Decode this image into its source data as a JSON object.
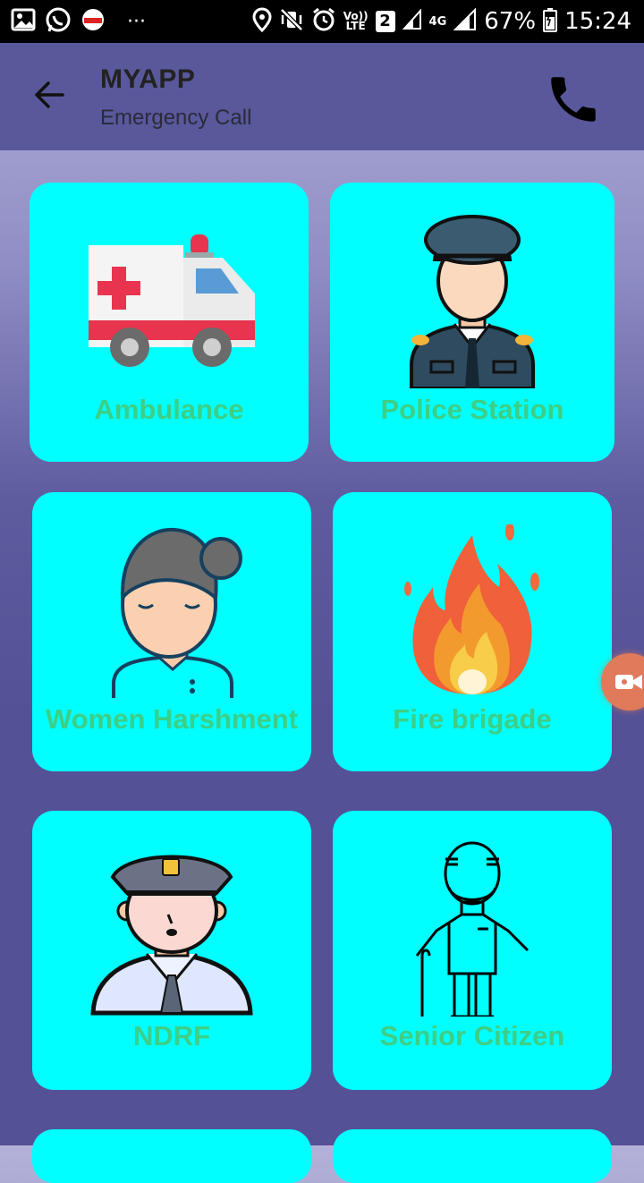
{
  "status_bar": {
    "lte_line1": "Vo))",
    "lte_line2": "LTE",
    "sim_badge": "2",
    "network": "4G",
    "battery": "67%",
    "time": "15:24",
    "dots": "···"
  },
  "app_bar": {
    "title": "MYAPP",
    "subtitle": "Emergency Call"
  },
  "cards": [
    {
      "label": "Ambulance"
    },
    {
      "label": "Police Station"
    },
    {
      "label": "Women Harshment"
    },
    {
      "label": "Fire brigade"
    },
    {
      "label": "NDRF"
    },
    {
      "label": "Senior Citizen"
    }
  ],
  "colors": {
    "card_bg": "#00ffff",
    "label": "#3dcf86",
    "app_bar": "#59589b"
  }
}
